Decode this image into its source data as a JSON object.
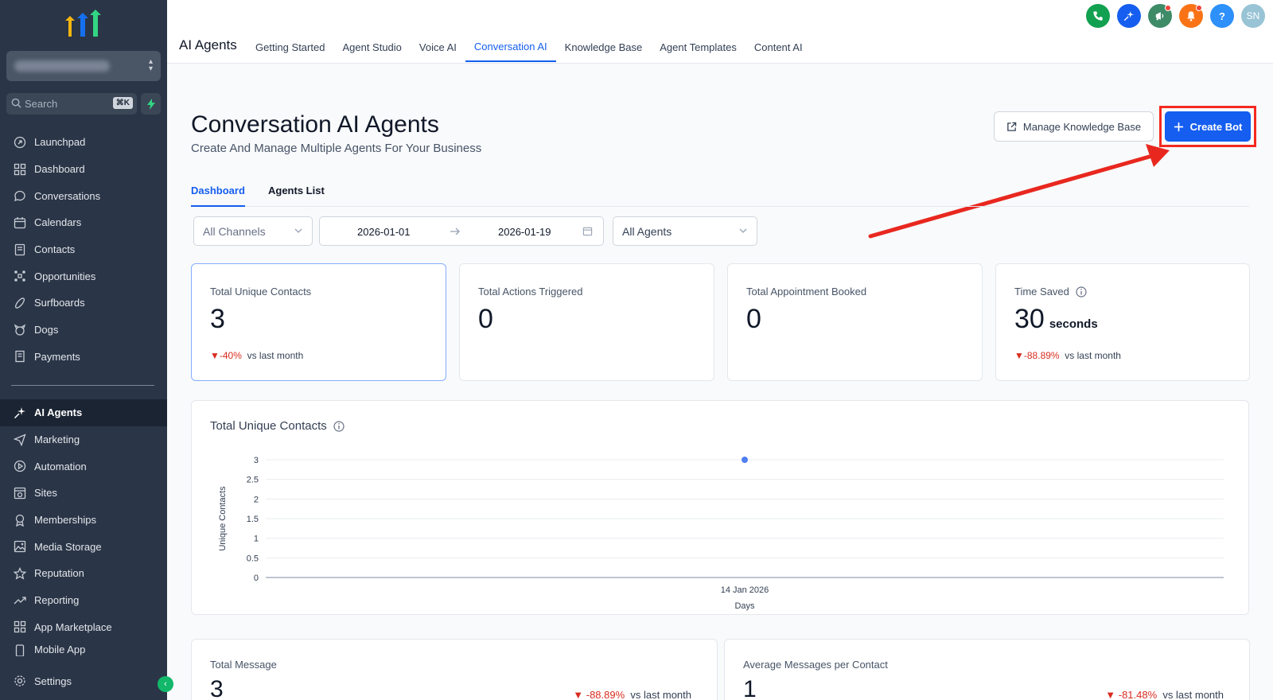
{
  "sidebar": {
    "search_placeholder": "Search",
    "search_shortcut": "⌘K",
    "items": [
      {
        "label": "Launchpad",
        "icon": "rocket-icon"
      },
      {
        "label": "Dashboard",
        "icon": "dashboard-grid-icon"
      },
      {
        "label": "Conversations",
        "icon": "chat-bubble-icon"
      },
      {
        "label": "Calendars",
        "icon": "calendar-icon"
      },
      {
        "label": "Contacts",
        "icon": "contacts-book-icon"
      },
      {
        "label": "Opportunities",
        "icon": "opportunities-icon"
      },
      {
        "label": "Surfboards",
        "icon": "surfboard-icon"
      },
      {
        "label": "Dogs",
        "icon": "dog-icon"
      },
      {
        "label": "Payments",
        "icon": "receipt-icon"
      }
    ],
    "items2": [
      {
        "label": "AI Agents",
        "icon": "sparkles-icon",
        "active": true
      },
      {
        "label": "Marketing",
        "icon": "send-icon"
      },
      {
        "label": "Automation",
        "icon": "automation-icon"
      },
      {
        "label": "Sites",
        "icon": "sites-icon"
      },
      {
        "label": "Memberships",
        "icon": "membership-icon"
      },
      {
        "label": "Media Storage",
        "icon": "image-icon"
      },
      {
        "label": "Reputation",
        "icon": "star-icon"
      },
      {
        "label": "Reporting",
        "icon": "trend-up-icon"
      },
      {
        "label": "App Marketplace",
        "icon": "apps-grid-icon"
      },
      {
        "label": "Mobile App",
        "icon": "mobile-icon"
      }
    ],
    "settings_label": "Settings"
  },
  "topbar": {
    "app_title": "AI Agents",
    "tabs": [
      "Getting Started",
      "Agent Studio",
      "Voice AI",
      "Conversation AI",
      "Knowledge Base",
      "Agent Templates",
      "Content AI"
    ],
    "active_tab": "Conversation AI",
    "avatar_initials": "SN",
    "help_label": "?",
    "colors": {
      "phone": "#12a150",
      "ai": "#155eef",
      "announce": "#3d8b67",
      "bell": "#f97316",
      "help": "#2e90fa",
      "avatar": "#98c4d6"
    }
  },
  "page": {
    "title": "Conversation AI Agents",
    "subtitle": "Create And Manage Multiple Agents For Your Business",
    "manage_kb_label": "Manage Knowledge Base",
    "create_bot_label": "Create Bot",
    "subtabs": [
      "Dashboard",
      "Agents List"
    ],
    "filters": {
      "channels": "All Channels",
      "date_from": "2026-01-01",
      "date_to": "2026-01-19",
      "agents": "All Agents"
    }
  },
  "stats": [
    {
      "label": "Total Unique Contacts",
      "value": "3",
      "delta": "-40%",
      "delta_suffix": "vs last month"
    },
    {
      "label": "Total Actions Triggered",
      "value": "0"
    },
    {
      "label": "Total Appointment Booked",
      "value": "0"
    },
    {
      "label": "Time Saved",
      "value": "30",
      "unit": "seconds",
      "delta": "-88.89%",
      "delta_suffix": "vs last month"
    }
  ],
  "chart_data": {
    "type": "scatter",
    "title": "Total Unique Contacts",
    "xlabel": "Days",
    "ylabel": "Unique Contacts",
    "categories": [
      "14 Jan 2026"
    ],
    "values": [
      3
    ],
    "yticks": [
      "0",
      "0.5",
      "1",
      "1.5",
      "2",
      "2.5",
      "3"
    ],
    "ylim": [
      0,
      3
    ],
    "grid": true,
    "color": "#4f7ef0"
  },
  "bottom": [
    {
      "label": "Total Message",
      "value": "3",
      "delta": "-88.89%",
      "delta_suffix": "vs last month"
    },
    {
      "label": "Average Messages per Contact",
      "value": "1",
      "delta": "-81.48%",
      "delta_suffix": "vs last month"
    }
  ]
}
